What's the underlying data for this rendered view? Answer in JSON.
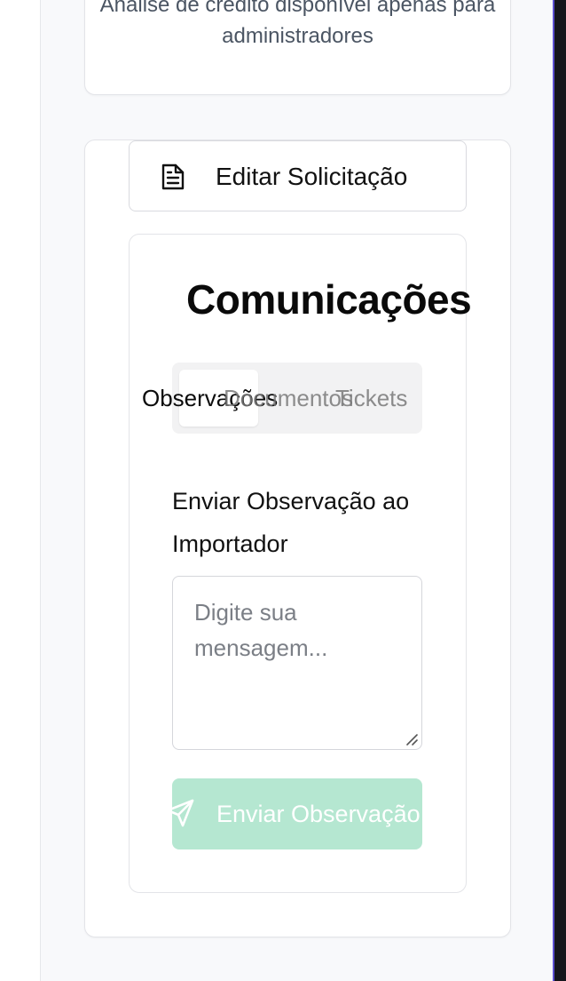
{
  "credit_card": {
    "message": "Análise de crédito disponível apenas para administradores"
  },
  "actions": {
    "edit_request_label": "Editar Solicitação",
    "edit_request_icon": "document-icon"
  },
  "communications": {
    "title": "Comunicações",
    "tabs": [
      {
        "label": "Observações",
        "active": true
      },
      {
        "label": "Documentos",
        "active": false
      },
      {
        "label": "Tickets",
        "active": false
      }
    ],
    "form": {
      "label": "Enviar Observação ao Importador",
      "message_value": "",
      "message_placeholder": "Digite sua mensagem...",
      "submit_label": "Enviar Observação",
      "submit_icon": "send-icon"
    }
  },
  "colors": {
    "submit_bg": "#b5e7d1",
    "card_border": "#e3e4e8",
    "page_bg": "#f8f9fb"
  }
}
